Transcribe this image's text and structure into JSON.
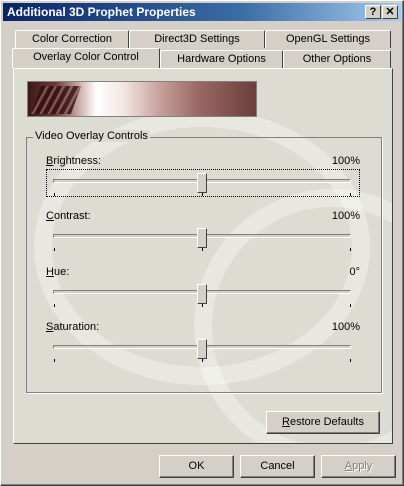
{
  "window": {
    "title": "Additional 3D Prophet Properties",
    "help_button": "?",
    "close_button": "✕"
  },
  "tabs_back": [
    "Color Correction",
    "Direct3D Settings",
    "OpenGL Settings"
  ],
  "tabs_front": [
    "Overlay Color Control",
    "Hardware Options",
    "Other Options"
  ],
  "active_tab": "Overlay Color Control",
  "group_title": "Video Overlay Controls",
  "sliders": [
    {
      "label": "Brightness:",
      "mnemonic": "B",
      "rest": "rightness:",
      "value_text": "100%",
      "level": 0.5
    },
    {
      "label": "Contrast:",
      "mnemonic": "C",
      "rest": "ontrast:",
      "value_text": "100%",
      "level": 0.5
    },
    {
      "label": "Hue:",
      "mnemonic": "H",
      "rest": "ue:",
      "value_text": "0°",
      "level": 0.5
    },
    {
      "label": "Saturation:",
      "mnemonic": "S",
      "rest": "aturation:",
      "value_text": "100%",
      "level": 0.5
    }
  ],
  "restore": {
    "mnemonic": "R",
    "rest": "estore Defaults"
  },
  "buttons": {
    "ok": "OK",
    "cancel": "Cancel",
    "apply_m": "A",
    "apply_rest": "pply"
  }
}
